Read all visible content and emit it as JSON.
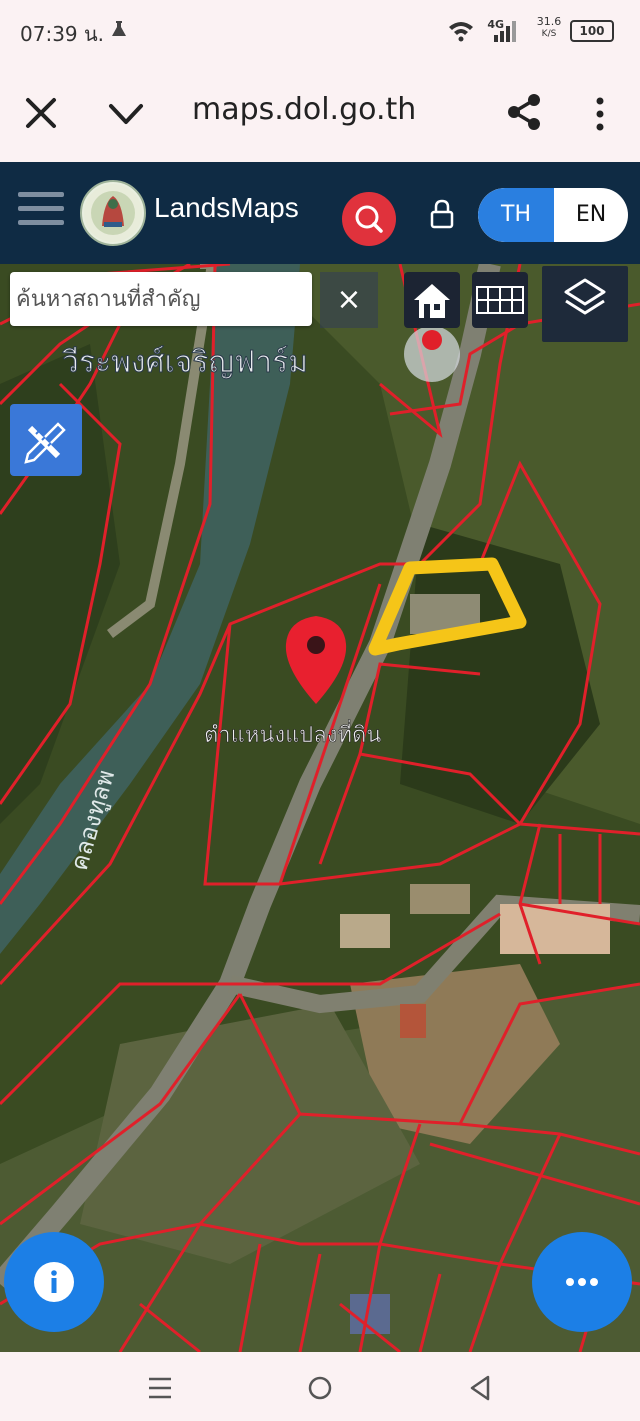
{
  "status_bar": {
    "time": "07:39 น.",
    "network": "4G",
    "speed_value": "31.6",
    "speed_unit": "K/S",
    "battery": "100",
    "icons": [
      "flask-icon",
      "wifi-icon",
      "signal-icon",
      "battery-icon"
    ]
  },
  "browser": {
    "url": "maps.dol.go.th",
    "icons": [
      "close-icon",
      "chevron-down-icon",
      "share-icon",
      "more-vert-icon"
    ]
  },
  "header": {
    "app_name": "LandsMaps",
    "lang_th": "TH",
    "lang_en": "EN",
    "active_lang": "TH",
    "colors": {
      "header_bg": "#0f2b44",
      "search_red": "#e0323c",
      "accent_blue": "#2a7fe0"
    },
    "icons": [
      "hamburger-icon",
      "logo-emblem",
      "search-icon",
      "lock-icon"
    ]
  },
  "map": {
    "search_placeholder": "ค้นหาสถานที่สำคัญ",
    "clear_label": "×",
    "labels": {
      "place_name": "วีระพงศ์เจริญฟาร์ม",
      "canal_name": "คลองทูลพ",
      "marker_label": "ตำแหน่งแปลงที่ดิน"
    },
    "colors": {
      "parcel_lines": "#e0202a",
      "highlight": "#f5c518",
      "marker": "#e8202f"
    },
    "icons": [
      "home-icon",
      "grid-icon",
      "layers-icon",
      "draw-ruler-icon",
      "info-icon",
      "more-horiz-icon",
      "map-pin-icon"
    ]
  },
  "nav_bar": {
    "icons": [
      "recent-apps-icon",
      "home-circle-icon",
      "back-icon"
    ]
  }
}
